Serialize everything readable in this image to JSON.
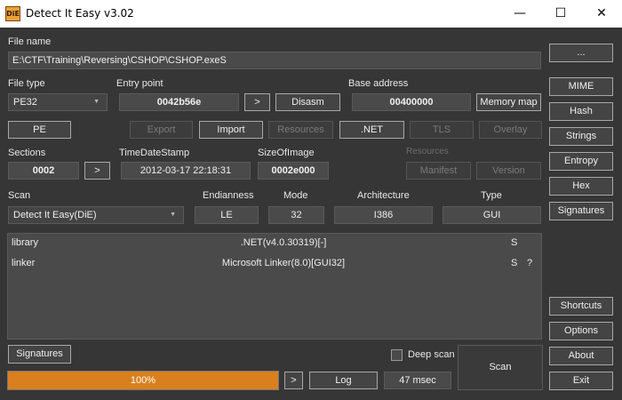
{
  "window": {
    "title": "Detect It Easy v3.02",
    "icon_text": "DiE",
    "minimize": "—",
    "maximize": "☐",
    "close": "✕"
  },
  "file": {
    "label": "File name",
    "path": "E:\\CTF\\Training\\Reversing\\CSHOP\\CSHOP.exeS",
    "browse_label": "..."
  },
  "file_type": {
    "label": "File type",
    "value": "PE32"
  },
  "entry_point": {
    "label": "Entry point",
    "value": "0042b56e",
    "next_label": ">",
    "disasm_label": "Disasm"
  },
  "base_address": {
    "label": "Base address",
    "value": "00400000",
    "memory_map_label": "Memory map"
  },
  "pe_buttons": {
    "pe": "PE",
    "export": "Export",
    "import": "Import",
    "resources": "Resources",
    "net": ".NET",
    "tls": "TLS",
    "overlay": "Overlay"
  },
  "sections": {
    "label": "Sections",
    "value": "0002",
    "next_label": ">"
  },
  "timestamp": {
    "label": "TimeDateStamp",
    "value": "2012-03-17 22:18:31"
  },
  "size_of_image": {
    "label": "SizeOfImage",
    "value": "0002e000"
  },
  "resources_group": {
    "label": "Resources",
    "manifest": "Manifest",
    "version": "Version"
  },
  "scan": {
    "label": "Scan",
    "engine": "Detect It Easy(DiE)",
    "endianness_label": "Endianness",
    "endianness": "LE",
    "mode_label": "Mode",
    "mode": "32",
    "architecture_label": "Architecture",
    "architecture": "I386",
    "type_label": "Type",
    "type": "GUI"
  },
  "results": [
    {
      "type": "library",
      "name": ".NET(v4.0.30319)[-]",
      "s": "S",
      "q": ""
    },
    {
      "type": "linker",
      "name": "Microsoft Linker(8.0)[GUI32]",
      "s": "S",
      "q": "?"
    }
  ],
  "bottom": {
    "signatures_label": "Signatures",
    "deep_scan_label": "Deep scan",
    "deep_scan_checked": false,
    "scan_label": "Scan",
    "progress_text": "100%",
    "progress": 1.0,
    "next_label": ">",
    "log_label": "Log",
    "time": "47 msec"
  },
  "side_buttons": {
    "mime": "MIME",
    "hash": "Hash",
    "strings": "Strings",
    "entropy": "Entropy",
    "hex": "Hex",
    "signatures": "Signatures",
    "shortcuts": "Shortcuts",
    "options": "Options",
    "about": "About",
    "exit": "Exit"
  },
  "colors": {
    "background": "#363636",
    "progress": "#d9801e"
  }
}
